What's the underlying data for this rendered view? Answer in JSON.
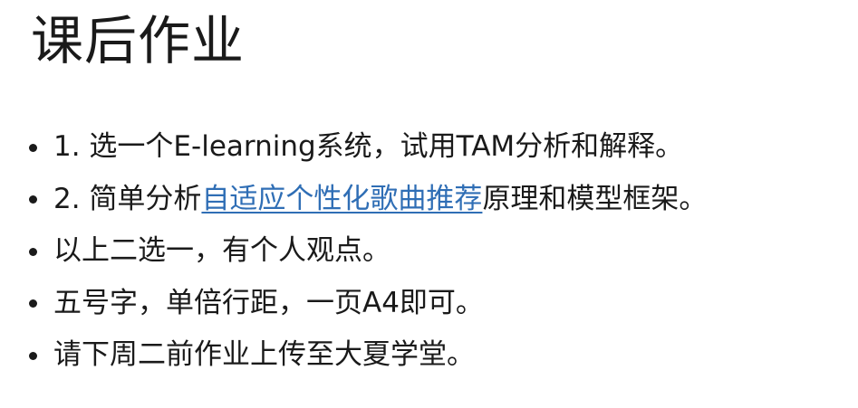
{
  "slide": {
    "title": "课后作业",
    "bullets": [
      {
        "text": "1. 选一个E-learning系统，试用TAM分析和解释。"
      },
      {
        "prefix": "2. 简单分析",
        "link": "自适应个性化歌曲推荐",
        "suffix": "原理和模型框架。"
      },
      {
        "text": "以上二选一，有个人观点。"
      },
      {
        "text": "五号字，单倍行距，一页A4即可。"
      },
      {
        "text": "请下周二前作业上传至大夏学堂。"
      }
    ]
  },
  "colors": {
    "text": "#1a1a1a",
    "link": "#2f6eb5",
    "background": "#ffffff"
  }
}
